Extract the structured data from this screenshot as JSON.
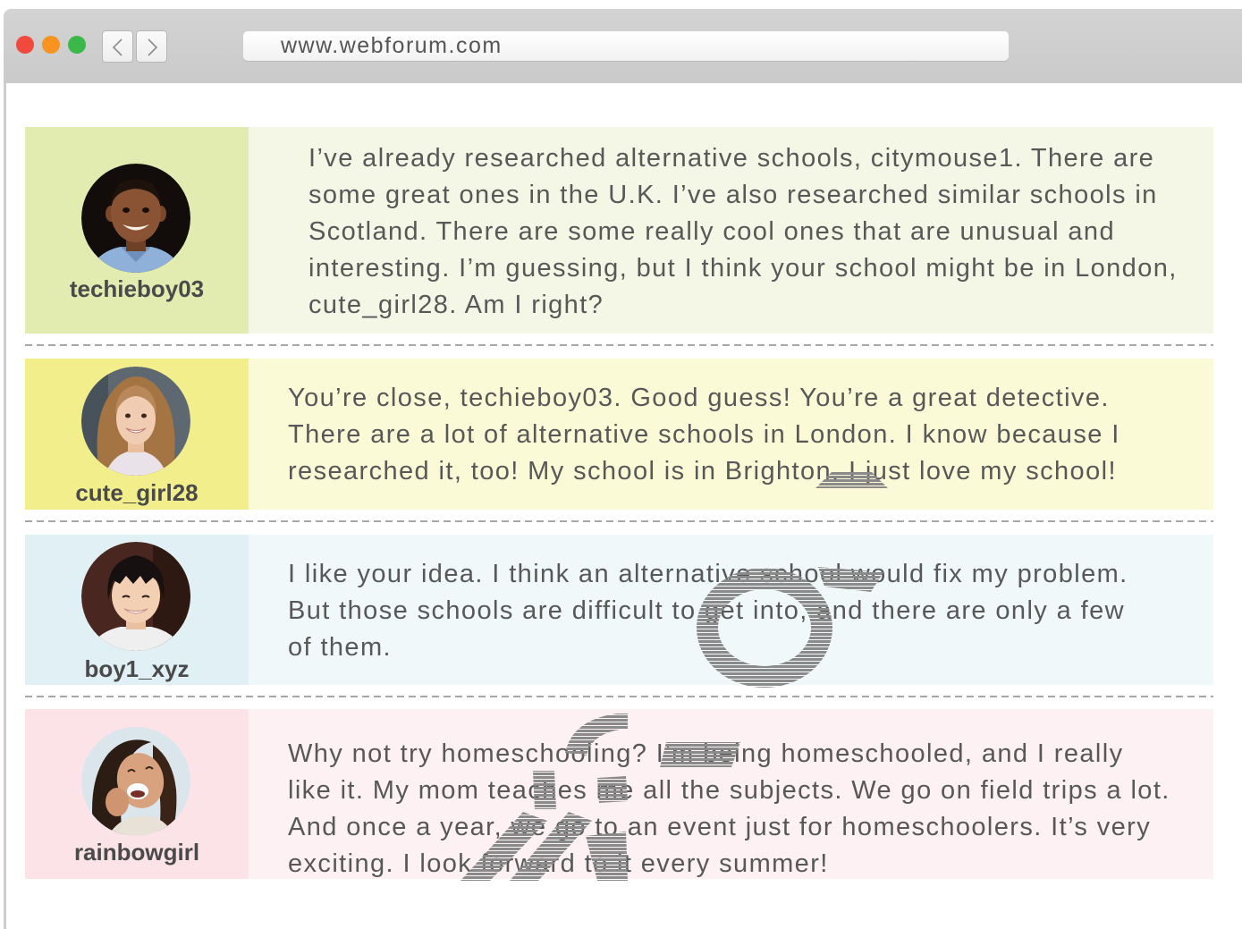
{
  "browser": {
    "url": "www.webforum.com",
    "window_controls": {
      "close": {
        "icon": "close-dot-icon",
        "color": "#ef4a3d"
      },
      "minimize": {
        "icon": "minimize-dot-icon",
        "color": "#f7941f"
      },
      "maximize": {
        "icon": "maximize-dot-icon",
        "color": "#3cb84b"
      }
    },
    "nav": {
      "back_icon": "chevron-left-icon",
      "forward_icon": "chevron-right-icon"
    }
  },
  "posts": [
    {
      "username": "techieboy03",
      "avatar": "boy-avatar",
      "colors": {
        "side": "#e2ecb1",
        "body": "#f4f7e5"
      },
      "lines": [
        "I’ve already researched alternative schools, citymouse1. There are",
        "some great ones in the U.K. I’ve also researched similar schools in",
        "Scotland. There are some really cool ones that are unusual and",
        "interesting. I’m guessing, but I think your school might be in London,",
        "cute_girl28. Am I right?"
      ]
    },
    {
      "username": "cute_girl28",
      "avatar": "girl-avatar",
      "colors": {
        "side": "#f2ee8c",
        "body": "#fbfad7"
      },
      "lines": [
        "You’re close, techieboy03. Good guess! You’re a great detective.",
        "There are a lot of alternative schools in London. I know because I",
        "researched it, too! My school is in Brighton. I just love my school!"
      ]
    },
    {
      "username": "boy1_xyz",
      "avatar": "boy-avatar",
      "colors": {
        "side": "#e0f0f4",
        "body": "#f0f8fa"
      },
      "lines": [
        "I like your idea. I think an alternative school would fix my problem.",
        "But those schools are difficult to get into, and there are only a few",
        "of them."
      ]
    },
    {
      "username": "rainbowgirl",
      "avatar": "girl-avatar",
      "colors": {
        "side": "#fbe3e7",
        "body": "#fdf1f3"
      },
      "lines": [
        "Why not try homeschooling? I’m being homeschooled, and I really",
        "like it. My mom teaches me all the subjects. We go on field trips a lot.",
        "And once a year, we go to an event just for homeschoolers. It’s very",
        "exciting. I look forward to it every summer!"
      ]
    }
  ]
}
